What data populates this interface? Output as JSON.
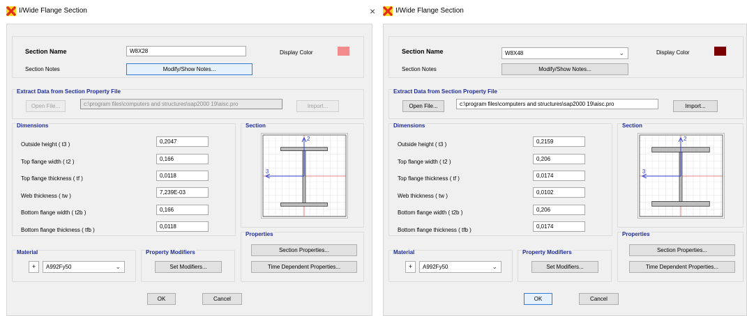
{
  "windows": [
    {
      "title": "I/Wide Flange Section",
      "section_name_label": "Section Name",
      "section_name_value": "W8X28",
      "display_color_label": "Display Color",
      "display_color": "#f28c8c",
      "section_notes_label": "Section Notes",
      "modify_notes_button": "Modify/Show Notes...",
      "extract_group_label": "Extract Data from Section Property File",
      "open_file_button": "Open File...",
      "file_path": "c:\\program files\\computers and structures\\sap2000 19\\aisc.pro",
      "import_button": "Import...",
      "dimensions_label": "Dimensions",
      "dimensions": [
        {
          "label": "Outside height  ( t3 )",
          "value": "0,2047"
        },
        {
          "label": "Top flange width  ( t2 )",
          "value": "0,166"
        },
        {
          "label": "Top flange thickness  ( tf )",
          "value": "0,0118"
        },
        {
          "label": "Web thickness  ( tw )",
          "value": "7,239E-03"
        },
        {
          "label": "Bottom flange width  ( t2b )",
          "value": "0,166"
        },
        {
          "label": "Bottom flange thickness  ( tfb )",
          "value": "0,0118"
        }
      ],
      "section_group_label": "Section",
      "axis_2": "2",
      "axis_3": "3",
      "properties_label": "Properties",
      "section_properties_button": "Section Properties...",
      "time_dependent_button": "Time Dependent Properties...",
      "material_label": "Material",
      "material_plus": "+",
      "material_value": "A992Fy50",
      "modifiers_label": "Property Modifiers",
      "set_modifiers_button": "Set Modifiers...",
      "ok_button": "OK",
      "cancel_button": "Cancel"
    },
    {
      "title": "I/Wide Flange Section",
      "section_name_label": "Section Name",
      "section_name_value": "W8X48",
      "display_color_label": "Display Color",
      "display_color": "#7a0000",
      "section_notes_label": "Section Notes",
      "modify_notes_button": "Modify/Show Notes...",
      "extract_group_label": "Extract Data from Section Property File",
      "open_file_button": "Open File...",
      "file_path": "c:\\program files\\computers and structures\\sap2000 19\\aisc.pro",
      "import_button": "Import...",
      "dimensions_label": "Dimensions",
      "dimensions": [
        {
          "label": "Outside height  ( t3 )",
          "value": "0,2159"
        },
        {
          "label": "Top flange width  ( t2 )",
          "value": "0,206"
        },
        {
          "label": "Top flange thickness  ( tf )",
          "value": "0,0174"
        },
        {
          "label": "Web thickness  ( tw )",
          "value": "0,0102"
        },
        {
          "label": "Bottom flange width  ( t2b )",
          "value": "0,206"
        },
        {
          "label": "Bottom flange thickness  ( tfb )",
          "value": "0,0174"
        }
      ],
      "section_group_label": "Section",
      "axis_2": "2",
      "axis_3": "3",
      "properties_label": "Properties",
      "section_properties_button": "Section Properties...",
      "time_dependent_button": "Time Dependent Properties...",
      "material_label": "Material",
      "material_plus": "+",
      "material_value": "A992Fy50",
      "modifiers_label": "Property Modifiers",
      "set_modifiers_button": "Set Modifiers...",
      "ok_button": "OK",
      "cancel_button": "Cancel"
    }
  ],
  "close_glyph": "×"
}
